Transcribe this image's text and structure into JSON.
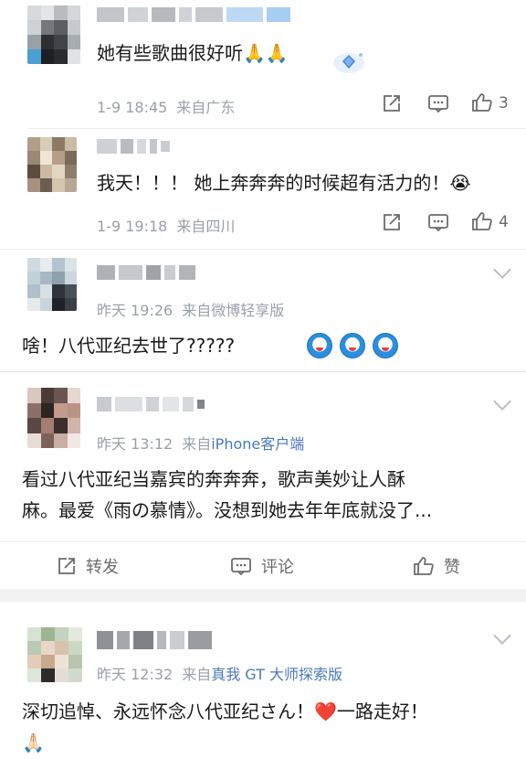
{
  "comments": [
    {
      "text": "她有些歌曲很好听🙏🙏",
      "time": "1-9 18:45",
      "location": "来自广东",
      "like_count": "3"
    },
    {
      "text": "我天！！！ 她上奔奔奔的时候超有活力的！😭",
      "time": "1-9 19:18",
      "location": "来自四川",
      "like_count": "4"
    },
    {
      "time": "昨天 19:26",
      "location": "来自微博轻享版",
      "text": "啥！八代亚纪去世了?????",
      "emoji": "doraemon-face-icon"
    },
    {
      "time": "昨天 13:12",
      "location_prefix": "来自",
      "location_link": "iPhone客户端",
      "text_line1": "看过八代亚纪当嘉宾的奔奔奔，歌声美妙让人酥",
      "text_line2": "麻。最爱《雨の慕情》。没想到她去年年底就没了..."
    },
    {
      "time": "昨天 12:32",
      "location_prefix": "来自",
      "location_link": "真我 GT 大师探索版",
      "text": "深切追悼、永远怀念八代亚纪さん！❤️一路走好！",
      "text_line2": "🙏🏻"
    }
  ],
  "actions": {
    "repost_label": "转发",
    "comment_label": "评论",
    "like_label": "赞"
  },
  "colors": {
    "link": "#4a78b6",
    "meta": "#9aa0a8",
    "divider": "#ececec"
  }
}
